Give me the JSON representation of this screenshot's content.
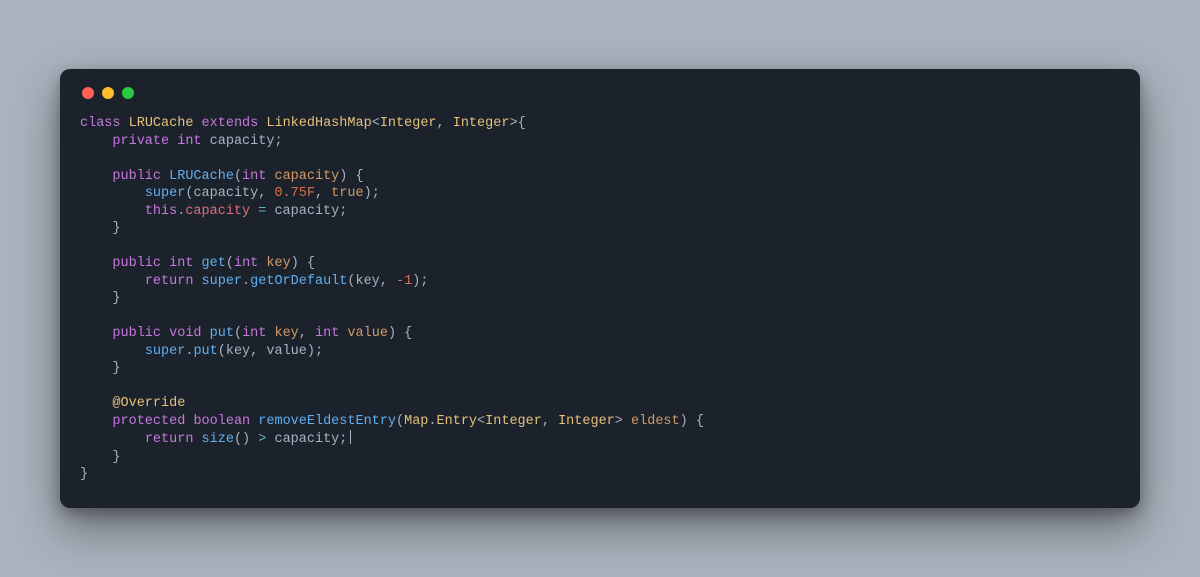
{
  "window": {
    "dots": [
      "red",
      "yellow",
      "green"
    ]
  },
  "tok": {
    "kw_class": "class",
    "LRUCache": "LRUCache",
    "kw_extends": "extends",
    "LinkedHashMap": "LinkedHashMap",
    "lt": "<",
    "Integer": "Integer",
    "comma_sp": ", ",
    "gt": ">",
    "ob": "{",
    "cb": "}",
    "op": "(",
    "cp": ")",
    "semi": ";",
    "kw_private": "private",
    "kw_public": "public",
    "kw_protected": "protected",
    "kw_return": "return",
    "kw_this": "this",
    "kw_int": "int",
    "kw_void": "void",
    "kw_boolean": "boolean",
    "capacity": "capacity",
    "key": "key",
    "value": "value",
    "eldest": "eldest",
    "fn_super": "super",
    "fn_get": "get",
    "fn_put": "put",
    "fn_getOrDefault": "getOrDefault",
    "fn_removeEldestEntry": "removeEldestEntry",
    "fn_size": "size",
    "Map": "Map",
    "dot": ".",
    "Entry": "Entry",
    "num_075F": "0.75F",
    "num_neg1": "-1",
    "lit_true": "true",
    "ann_Override": "@Override",
    "eq": " = ",
    "gt_op": " > "
  },
  "indent": {
    "i1": "    ",
    "i2": "        "
  }
}
